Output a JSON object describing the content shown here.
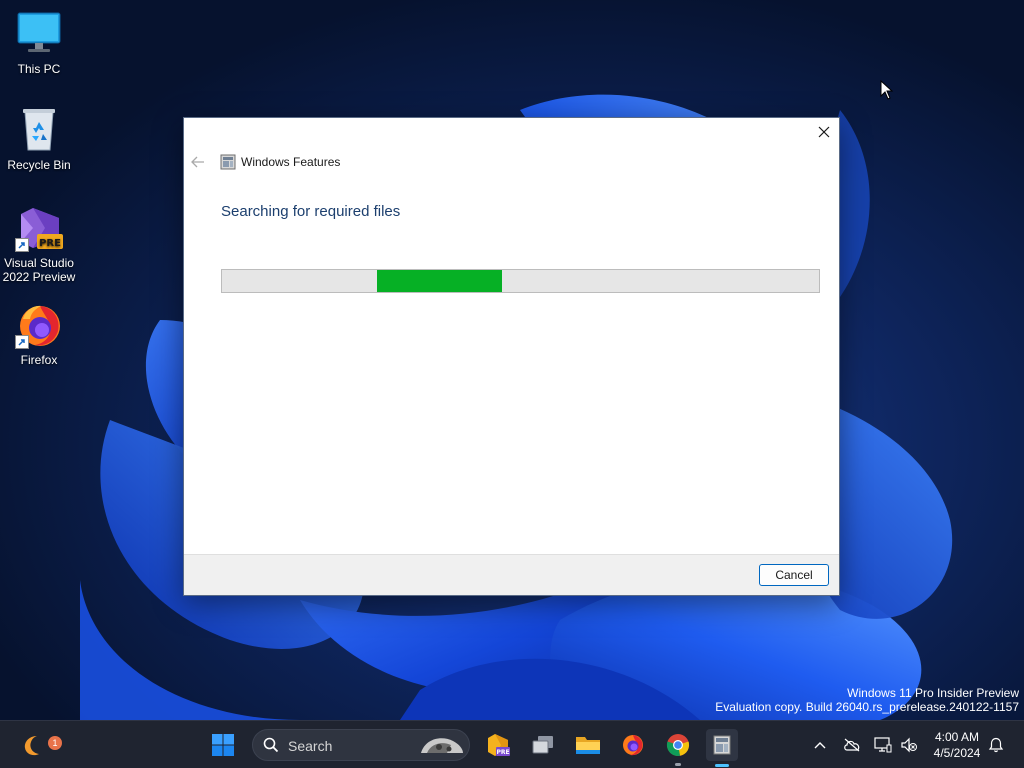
{
  "desktop": {
    "icons": [
      {
        "label": "This PC",
        "icon": "monitor-icon"
      },
      {
        "label": "Recycle Bin",
        "icon": "recycle-bin-icon"
      },
      {
        "label": "Visual Studio\n2022 Preview",
        "icon": "visual-studio-icon",
        "badge": "PRE"
      },
      {
        "label": "Firefox",
        "icon": "firefox-icon"
      }
    ],
    "watermark": {
      "line1": "Windows 11 Pro Insider Preview",
      "line2": "Evaluation copy. Build 26040.rs_prerelease.240122-1157"
    }
  },
  "dialog": {
    "title": "Windows Features",
    "heading": "Searching for required files",
    "progress": {
      "state": "marquee",
      "start_fraction": 0.26,
      "end_fraction": 0.47,
      "color": "#06b025"
    },
    "cancel_label": "Cancel"
  },
  "taskbar": {
    "widget_badge": "1",
    "search_placeholder": "Search",
    "pinned": [
      "start-icon",
      "search",
      "visual-studio-preview-icon",
      "task-view-icon",
      "file-explorer-icon",
      "firefox-icon",
      "chrome-icon",
      "windows-features-icon"
    ],
    "clock": {
      "time": "4:00 AM",
      "date": "4/5/2024"
    }
  },
  "colors": {
    "accent": "#0067c0",
    "heading": "#1c3f6e",
    "taskbar": "#1f2430"
  }
}
